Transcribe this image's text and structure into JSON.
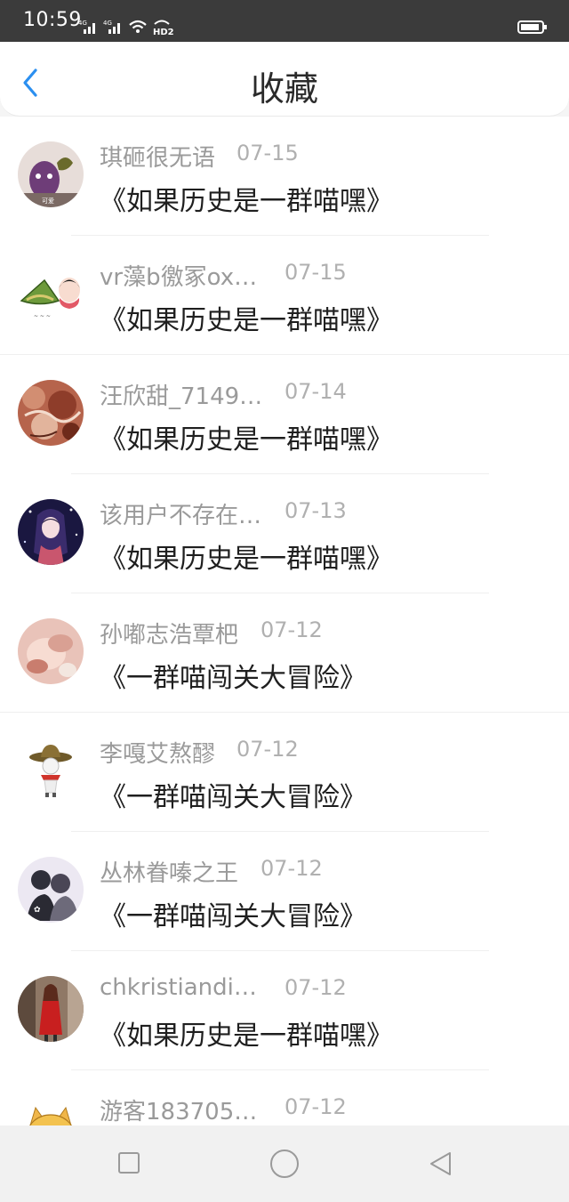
{
  "status_bar": {
    "time": "10:59",
    "indicators": [
      "4G-signal-icon",
      "4G-signal-icon",
      "wifi-icon",
      "HD2-icon",
      "battery-icon"
    ]
  },
  "header": {
    "title": "收藏",
    "back_icon": "chevron-left-icon",
    "accent": "#2b8ff0"
  },
  "favorites": [
    {
      "name": "琪砸很无语",
      "date": "07-15",
      "work": "《如果历史是一群喵嘿》",
      "avatar": "purple-character-avatar"
    },
    {
      "name": "vr藻b徼冢ox…",
      "date": "07-15",
      "work": "《如果历史是一群喵嘿》",
      "avatar": "zongzi-cartoon-avatar"
    },
    {
      "name": "汪欣甜_7149…",
      "date": "07-14",
      "work": "《如果历史是一群喵嘿》",
      "avatar": "red-pattern-avatar"
    },
    {
      "name": "该用户不存在…",
      "date": "07-13",
      "work": "《如果历史是一群喵嘿》",
      "avatar": "anime-girl-avatar"
    },
    {
      "name": "孙嘟志浩覃杷",
      "date": "07-12",
      "work": "《一群喵闯关大冒险》",
      "avatar": "pink-photo-avatar"
    },
    {
      "name": "李嘎艾熬醪",
      "date": "07-12",
      "work": "《一群喵闯关大冒险》",
      "avatar": "cowboy-figure-avatar"
    },
    {
      "name": "丛林眷嗪之王",
      "date": "07-12",
      "work": "《一群喵闯关大冒险》",
      "avatar": "couple-sketch-avatar"
    },
    {
      "name": "chkristiandio…",
      "date": "07-12",
      "work": "《如果历史是一群喵嘿》",
      "avatar": "red-dress-photo-avatar"
    },
    {
      "name": "游客1837052…",
      "date": "07-12",
      "work": "",
      "avatar": "cartoon-cat-avatar"
    }
  ],
  "navbar": {
    "recent_icon": "square-icon",
    "home_icon": "circle-icon",
    "back_icon": "triangle-back-icon"
  }
}
